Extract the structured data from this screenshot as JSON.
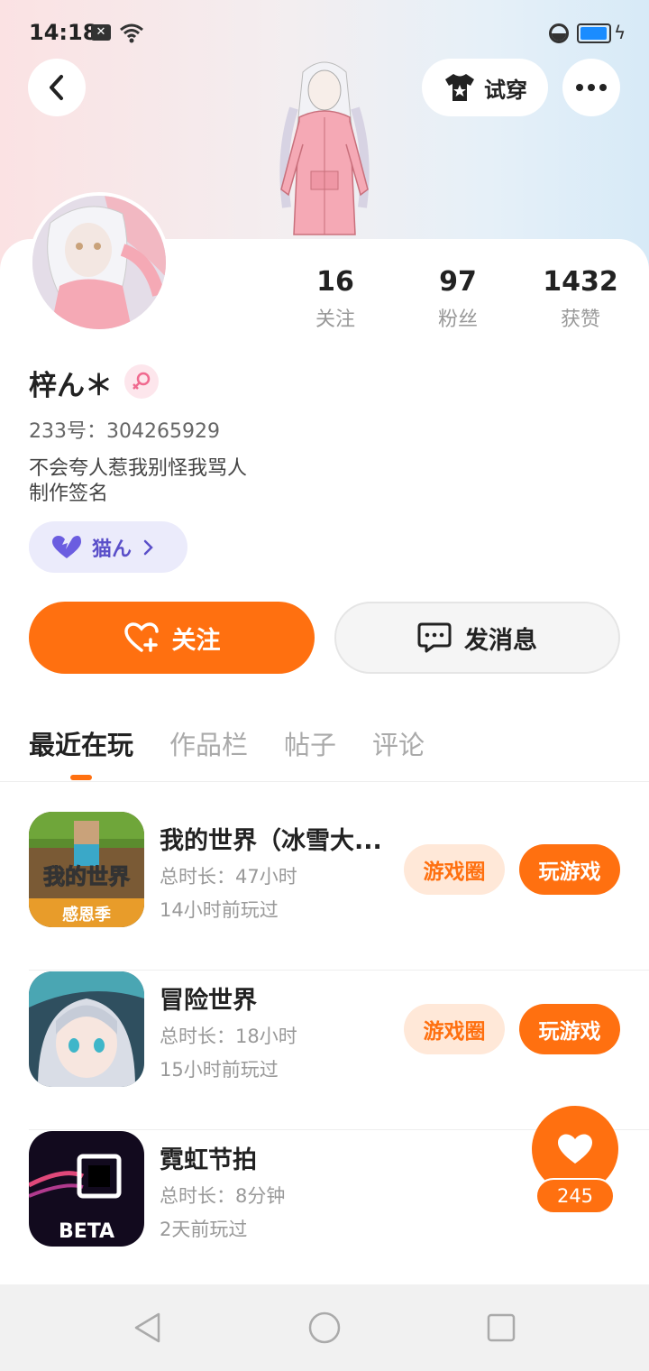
{
  "status_bar": {
    "time": "14:18",
    "x_badge": "✕",
    "battery_level_percent": 95
  },
  "header": {
    "try_on_label": "试穿"
  },
  "profile": {
    "username": "梓ん＊",
    "gender": "female",
    "uid_text": "233号：304265929",
    "bio_line1": "不会夸人惹我别怪我骂人",
    "bio_line2": "制作签名",
    "tag_label": "猫ん",
    "stats": [
      {
        "value": "16",
        "label": "关注"
      },
      {
        "value": "97",
        "label": "粉丝"
      },
      {
        "value": "1432",
        "label": "获赞"
      }
    ]
  },
  "actions": {
    "follow_label": "关注",
    "message_label": "发消息"
  },
  "tabs": [
    {
      "label": "最近在玩",
      "active": true
    },
    {
      "label": "作品栏",
      "active": false
    },
    {
      "label": "帖子",
      "active": false
    },
    {
      "label": "评论",
      "active": false
    }
  ],
  "games": [
    {
      "title": "我的世界（冰雪大...",
      "duration": "总时长：47小时",
      "last_played": "14小时前玩过",
      "circle_label": "游戏圈",
      "play_label": "玩游戏",
      "icon_text": "我的世界",
      "icon_subtext": "感恩季"
    },
    {
      "title": "冒险世界",
      "duration": "总时长：18小时",
      "last_played": "15小时前玩过",
      "circle_label": "游戏圈",
      "play_label": "玩游戏"
    },
    {
      "title": "霓虹节拍",
      "duration": "总时长：8分钟",
      "last_played": "2天前玩过",
      "icon_text": "BETA"
    }
  ],
  "fab": {
    "like_count": "245"
  },
  "colors": {
    "accent": "#ff7010",
    "tag_text": "#5a4fc9",
    "tag_bg": "#ebebfb"
  }
}
